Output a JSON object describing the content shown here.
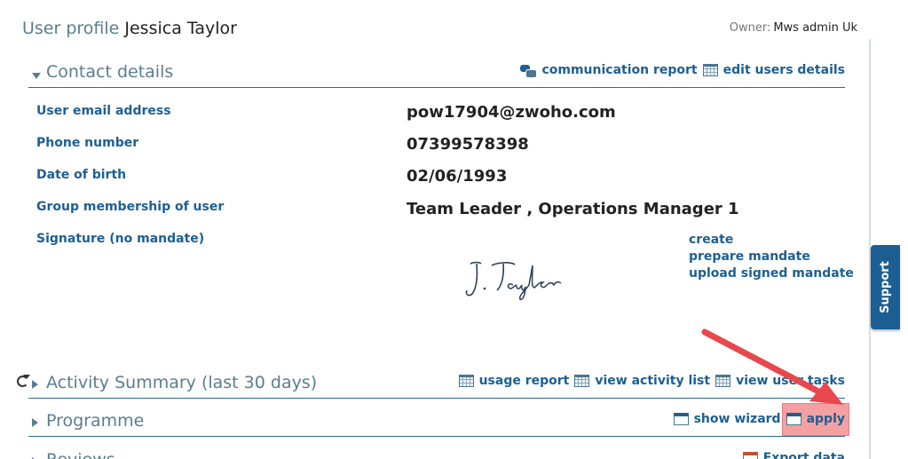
{
  "header": {
    "title_prefix": "User profile",
    "user_name": "Jessica Taylor",
    "owner_label": "Owner:",
    "owner_name": "Mws admin Uk"
  },
  "support_label": "Support",
  "contact": {
    "title": "Contact details",
    "links": {
      "communication_report": "communication report",
      "edit_users_details": "edit users details"
    },
    "fields": [
      {
        "label": "User email address",
        "value": "pow17904@zwoho.com"
      },
      {
        "label": "Phone number",
        "value": "07399578398"
      },
      {
        "label": "Date of birth",
        "value": "02/06/1993"
      },
      {
        "label": "Group membership of user",
        "value": "Team Leader , Operations Manager 1"
      },
      {
        "label": "Signature (no mandate)",
        "value": ""
      }
    ],
    "signature_text": "J. Taylor",
    "signature_links": {
      "create": "create",
      "prepare_mandate": "prepare mandate",
      "upload_signed_mandate": "upload signed mandate"
    }
  },
  "activity": {
    "title": "Activity Summary (last 30 days)",
    "links": {
      "usage_report": "usage report",
      "view_activity_list": "view activity list",
      "view_user_tasks": "view user tasks"
    }
  },
  "programme": {
    "title": "Programme",
    "links": {
      "show_wizard": "show wizard",
      "apply": "apply"
    }
  },
  "reviews": {
    "title": "Reviews",
    "links": {
      "export_data": "Export data"
    }
  },
  "colors": {
    "accent": "#1d5f93",
    "heading": "#5b7d90",
    "highlight": "#f4a0a3",
    "arrow": "#e8474d"
  }
}
